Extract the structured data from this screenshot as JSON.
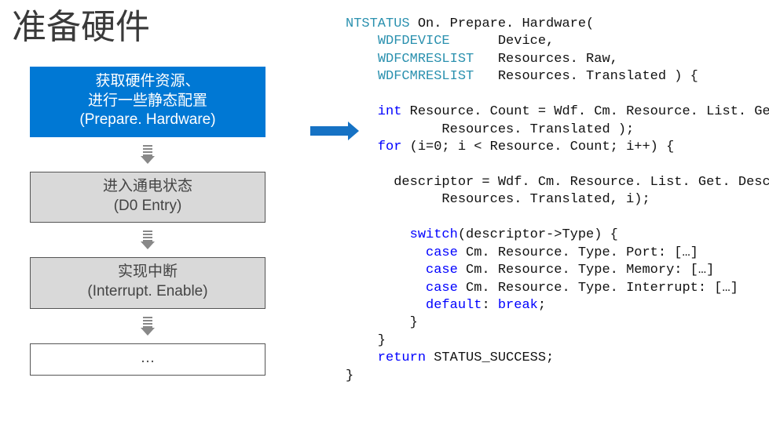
{
  "slide": {
    "title": "准备硬件",
    "steps": {
      "step1_line1": "获取硬件资源、",
      "step1_line2": "进行一些静态配置",
      "step1_line3": "(Prepare. Hardware)",
      "step2_line1": "进入通电状态",
      "step2_line2": "(D0 Entry)",
      "step3_line1": "实现中断",
      "step3_line2": "(Interrupt. Enable)",
      "step4": "…"
    },
    "code": {
      "sig_type": "NTSTATUS",
      "sig_name": " On. Prepare. Hardware(",
      "p1_type": "WDFDEVICE",
      "p1_name": "Device,",
      "p2_type": "WDFCMRESLIST",
      "p2_name": "Resources. Raw,",
      "p3_type": "WDFCMRESLIST",
      "p3_name": "Resources. Translated ) {",
      "l_count1": "    int",
      "l_count2": " Resource. Count = Wdf. Cm. Resource. List. Get. Count(",
      "l_count3": "            Resources. Translated );",
      "l_for1": "    for",
      "l_for2": " (i=0; i < Resource. Count; i++) {",
      "l_desc": "      descriptor = Wdf. Cm. Resource. List. Get. Descriptor(",
      "l_desc2": "            Resources. Translated, i);",
      "l_switch1": "        switch",
      "l_switch2": "(descriptor->Type) {",
      "l_case1a": "          case",
      "l_case1b": " Cm. Resource. Type. Port: […]",
      "l_case2a": "          case",
      "l_case2b": " Cm. Resource. Type. Memory: […]",
      "l_case3a": "          case",
      "l_case3b": " Cm. Resource. Type. Interrupt: […]",
      "l_def1": "          default",
      "l_def2": ": ",
      "l_def3": "break",
      "l_def4": ";",
      "l_close1": "        }",
      "l_close2": "    }",
      "l_ret1": "    return",
      "l_ret2": " STATUS_SUCCESS;",
      "l_close3": "}"
    }
  }
}
